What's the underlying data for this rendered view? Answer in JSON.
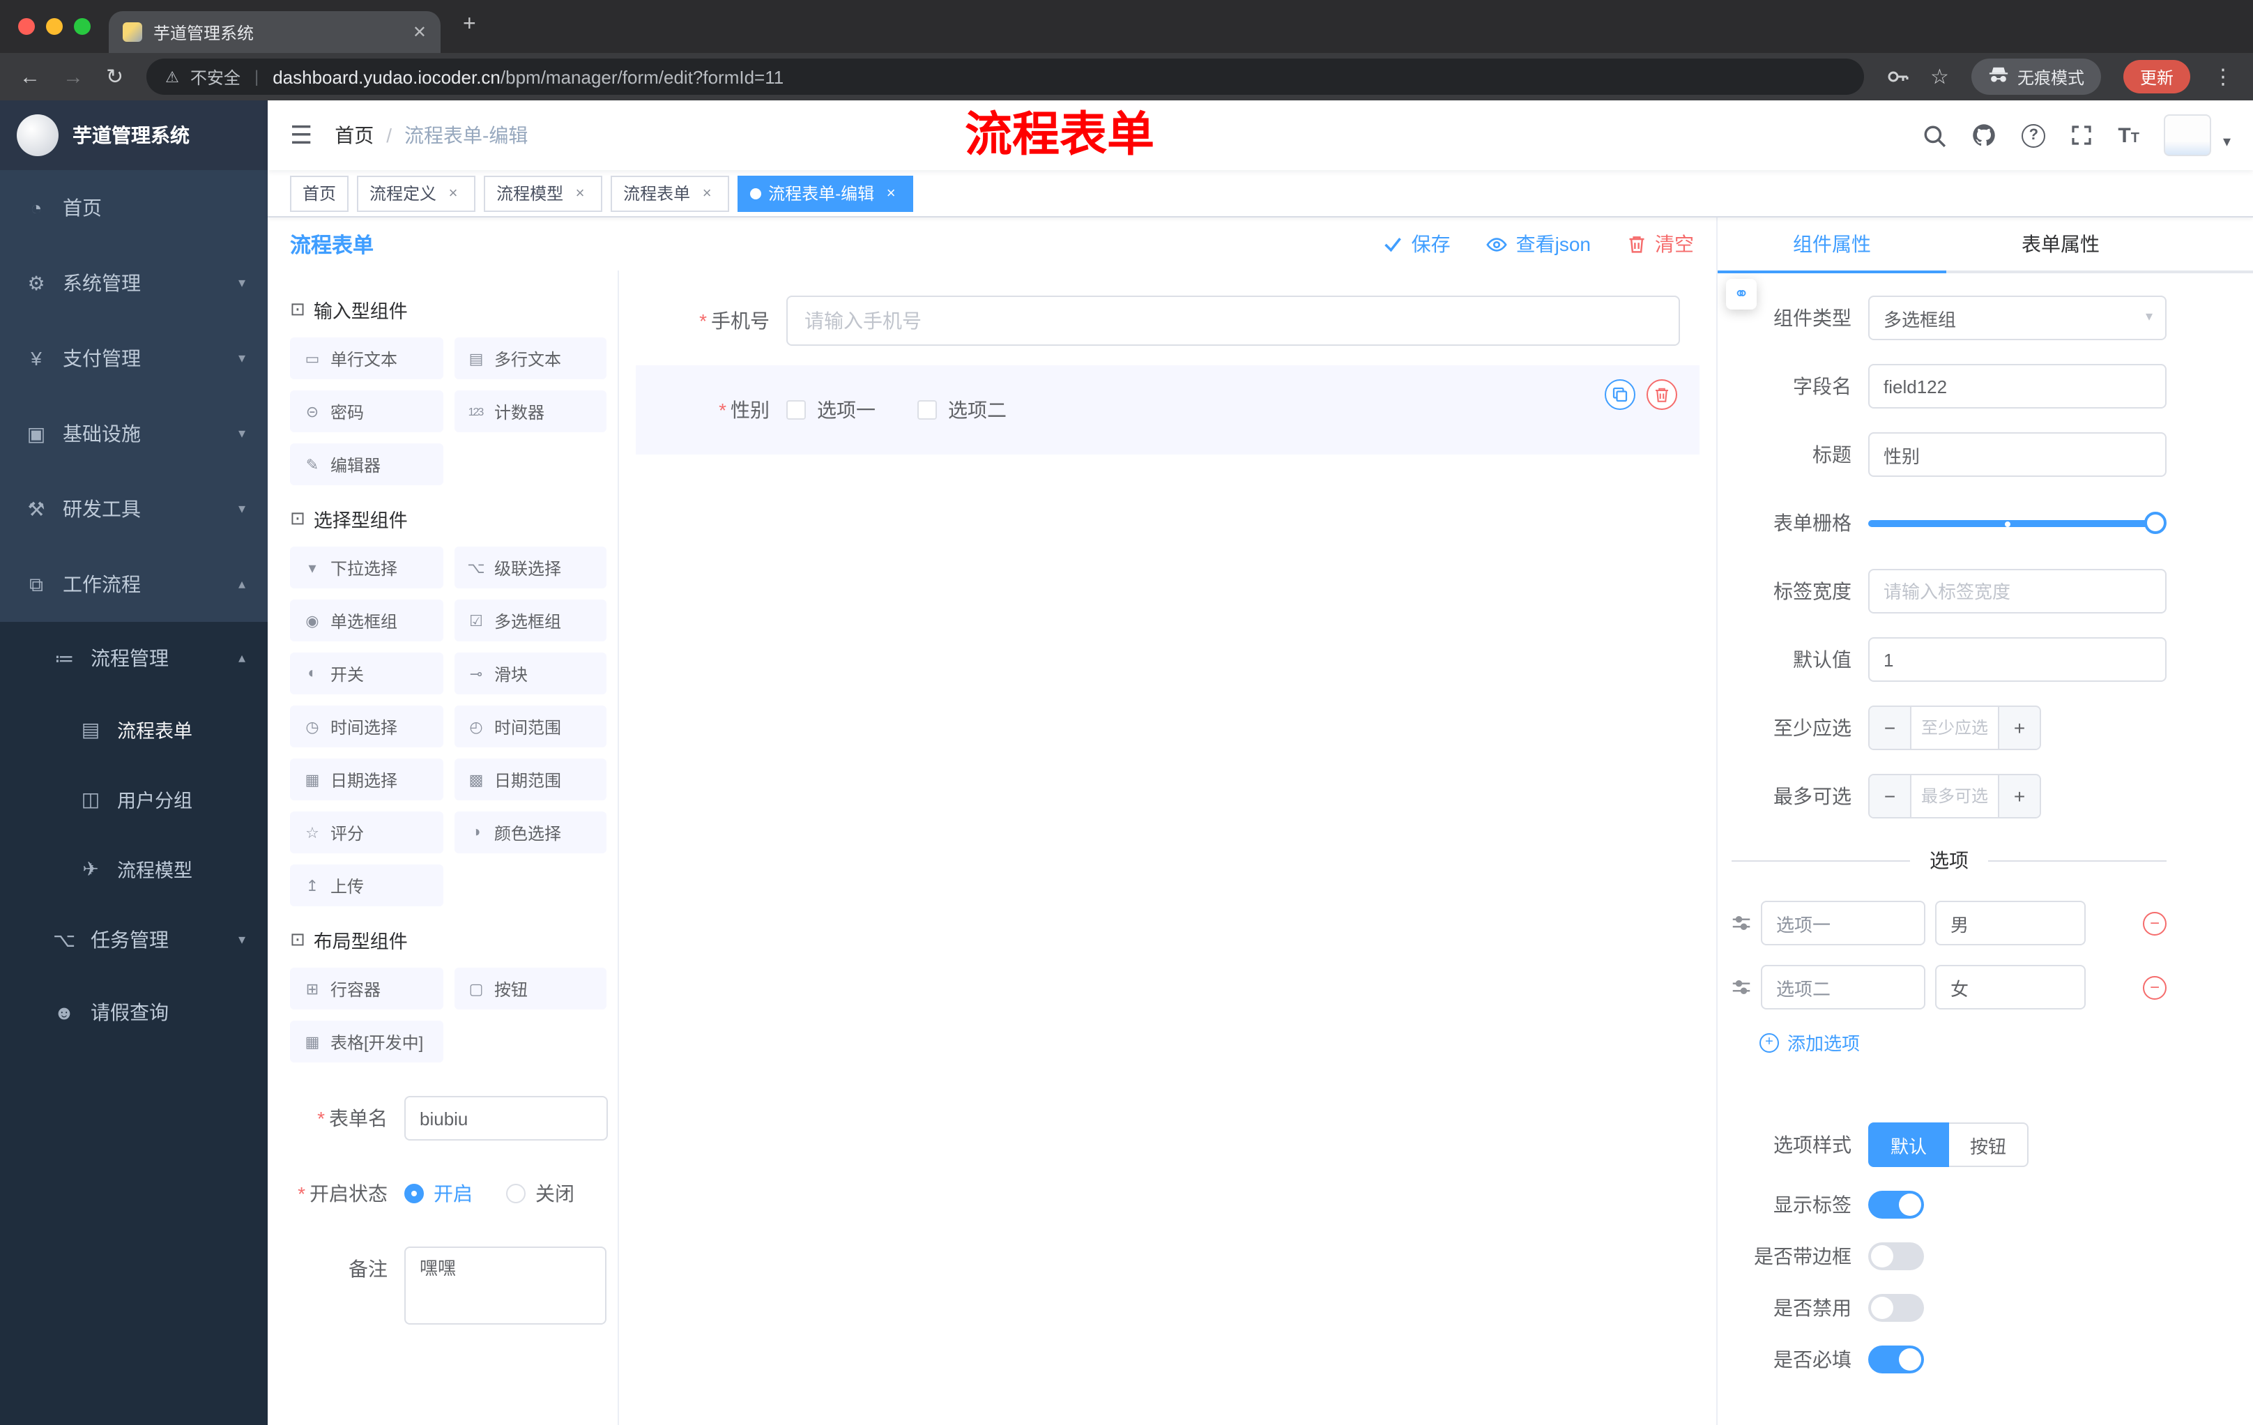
{
  "chrome": {
    "tab_title": "芋道管理系统",
    "close_tab": "✕",
    "new_tab": "+",
    "back": "←",
    "forward": "→",
    "reload": "↻",
    "warning_icon": "⚠",
    "security_label": "不安全",
    "url_separator": "|",
    "url_domain": "dashboard.yudao.iocoder.cn",
    "url_path": "/bpm/manager/form/edit?formId=11",
    "star_icon": "☆",
    "incognito_label": "无痕模式",
    "update_label": "更新",
    "menu_dots": "⋮"
  },
  "sidebar": {
    "title": "芋道管理系统",
    "menu": [
      {
        "icon": "◔",
        "label": "首页",
        "arrow": ""
      },
      {
        "icon": "⚙",
        "label": "系统管理",
        "arrow": "▾"
      },
      {
        "icon": "¥",
        "label": "支付管理",
        "arrow": "▾"
      },
      {
        "icon": "▣",
        "label": "基础设施",
        "arrow": "▾"
      },
      {
        "icon": "⚒",
        "label": "研发工具",
        "arrow": "▾"
      },
      {
        "icon": "⧉",
        "label": "工作流程",
        "arrow": "▴"
      },
      {
        "icon": "≔",
        "label": "流程管理",
        "arrow": "▴"
      },
      {
        "icon": "▤",
        "label": "流程表单",
        "arrow": ""
      },
      {
        "icon": "◫",
        "label": "用户分组",
        "arrow": ""
      },
      {
        "icon": "✈",
        "label": "流程模型",
        "arrow": ""
      },
      {
        "icon": "⌥",
        "label": "任务管理",
        "arrow": "▾"
      },
      {
        "icon": "☻",
        "label": "请假查询",
        "arrow": ""
      }
    ]
  },
  "header": {
    "hamburger": "☰",
    "breadcrumb_home": "首页",
    "breadcrumb_sep": "/",
    "breadcrumb_current": "流程表单-编辑",
    "annotation": "流程表单",
    "avatar_caret": "▾"
  },
  "tags": [
    {
      "label": "首页",
      "active": false
    },
    {
      "label": "流程定义",
      "active": false
    },
    {
      "label": "流程模型",
      "active": false
    },
    {
      "label": "流程表单",
      "active": false
    },
    {
      "label": "流程表单-编辑",
      "active": true
    }
  ],
  "tag_close": "×",
  "editor": {
    "title": "流程表单",
    "save": "保存",
    "view_json": "查看json",
    "clear": "清空"
  },
  "palette": {
    "sections": [
      {
        "icon": "⊡",
        "title": "输入型组件",
        "items": [
          {
            "glyph": "▭",
            "label": "单行文本"
          },
          {
            "glyph": "▤",
            "label": "多行文本"
          },
          {
            "glyph": "⊝",
            "label": "密码"
          },
          {
            "glyph": "123",
            "label": "计数器"
          },
          {
            "glyph": "✎",
            "label": "编辑器"
          }
        ]
      },
      {
        "icon": "⊡",
        "title": "选择型组件",
        "items": [
          {
            "glyph": "▾",
            "label": "下拉选择"
          },
          {
            "glyph": "⌥",
            "label": "级联选择"
          },
          {
            "glyph": "◉",
            "label": "单选框组"
          },
          {
            "glyph": "☑",
            "label": "多选框组"
          },
          {
            "glyph": "◐",
            "label": "开关"
          },
          {
            "glyph": "⊸",
            "label": "滑块"
          },
          {
            "glyph": "◷",
            "label": "时间选择"
          },
          {
            "glyph": "◴",
            "label": "时间范围"
          },
          {
            "glyph": "▦",
            "label": "日期选择"
          },
          {
            "glyph": "▩",
            "label": "日期范围"
          },
          {
            "glyph": "☆",
            "label": "评分"
          },
          {
            "glyph": "◑",
            "label": "颜色选择"
          },
          {
            "glyph": "↥",
            "label": "上传"
          }
        ]
      },
      {
        "icon": "⊡",
        "title": "布局型组件",
        "items": [
          {
            "glyph": "⊞",
            "label": "行容器"
          },
          {
            "glyph": "▢",
            "label": "按钮"
          },
          {
            "glyph": "▦",
            "label": "表格[开发中]"
          }
        ]
      }
    ],
    "meta": {
      "name_label": "表单名",
      "name_value": "biubiu",
      "status_label": "开启状态",
      "status_on": "开启",
      "status_on_selected": true,
      "status_off": "关闭",
      "remark_label": "备注",
      "remark_value": "嘿嘿"
    }
  },
  "canvas": {
    "phone_label": "手机号",
    "phone_placeholder": "请输入手机号",
    "gender_label": "性别",
    "gender_options": [
      "选项一",
      "选项二"
    ]
  },
  "props": {
    "tab_component": "组件属性",
    "tab_form": "表单属性",
    "link_glyph": "⚭",
    "rows": {
      "type_label": "组件类型",
      "type_value": "多选框组",
      "field_label": "字段名",
      "field_value": "field122",
      "title_label": "标题",
      "title_value": "性别",
      "grid_label": "表单栅格",
      "labelw_label": "标签宽度",
      "labelw_placeholder": "请输入标签宽度",
      "default_label": "默认值",
      "default_value": "1",
      "min_label": "至少应选",
      "min_placeholder": "至少应选",
      "max_label": "最多可选",
      "max_placeholder": "最多可选"
    },
    "options_divider": "选项",
    "options": [
      {
        "name": "选项一",
        "value": "男"
      },
      {
        "name": "选项二",
        "value": "女"
      }
    ],
    "add_option": "添加选项",
    "style_label": "选项样式",
    "style_default": "默认",
    "style_default_active": true,
    "style_button": "按钮",
    "switches": [
      {
        "label": "显示标签",
        "on": true
      },
      {
        "label": "是否带边框",
        "on": false
      },
      {
        "label": "是否禁用",
        "on": false
      },
      {
        "label": "是否必填",
        "on": true
      }
    ]
  },
  "colors": {
    "accent": "#409eff",
    "danger": "#f56c6c",
    "annotation": "#ff0000"
  }
}
